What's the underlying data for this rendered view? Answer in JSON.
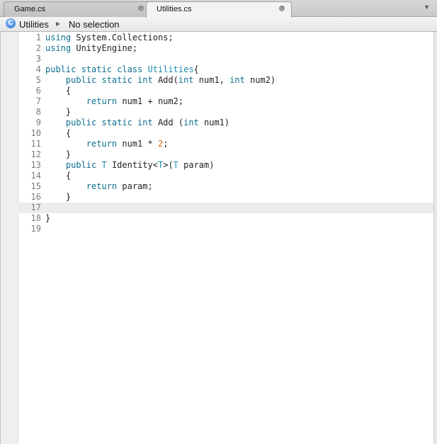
{
  "tabs": [
    {
      "label": "Game.cs"
    },
    {
      "label": "Utilities.cs"
    }
  ],
  "breadcrumb": {
    "class_icon_letter": "C",
    "class_name": "Utilities",
    "member": "No selection"
  },
  "editor": {
    "current_line": 17,
    "lines": [
      {
        "n": "1",
        "tokens": [
          {
            "t": "using",
            "c": "kw"
          },
          {
            "t": " System.Collections;",
            "c": "txt"
          }
        ]
      },
      {
        "n": "2",
        "tokens": [
          {
            "t": "using",
            "c": "kw"
          },
          {
            "t": " UnityEngine;",
            "c": "txt"
          }
        ]
      },
      {
        "n": "3",
        "tokens": []
      },
      {
        "n": "4",
        "tokens": [
          {
            "t": "public static class",
            "c": "kw"
          },
          {
            "t": " ",
            "c": "txt"
          },
          {
            "t": "Utilities",
            "c": "ty"
          },
          {
            "t": "{",
            "c": "txt"
          }
        ]
      },
      {
        "n": "5",
        "tokens": [
          {
            "t": "    ",
            "c": "txt"
          },
          {
            "t": "public static int",
            "c": "kw"
          },
          {
            "t": " Add(",
            "c": "txt"
          },
          {
            "t": "int",
            "c": "kw"
          },
          {
            "t": " num1, ",
            "c": "txt"
          },
          {
            "t": "int",
            "c": "kw"
          },
          {
            "t": " num2)",
            "c": "txt"
          }
        ]
      },
      {
        "n": "6",
        "tokens": [
          {
            "t": "    {",
            "c": "txt"
          }
        ]
      },
      {
        "n": "7",
        "tokens": [
          {
            "t": "        ",
            "c": "txt"
          },
          {
            "t": "return",
            "c": "kw"
          },
          {
            "t": " num1 + num2;",
            "c": "txt"
          }
        ]
      },
      {
        "n": "8",
        "tokens": [
          {
            "t": "    }",
            "c": "txt"
          }
        ]
      },
      {
        "n": "9",
        "tokens": [
          {
            "t": "    ",
            "c": "txt"
          },
          {
            "t": "public static int",
            "c": "kw"
          },
          {
            "t": " Add (",
            "c": "txt"
          },
          {
            "t": "int",
            "c": "kw"
          },
          {
            "t": " num1)",
            "c": "txt"
          }
        ]
      },
      {
        "n": "10",
        "tokens": [
          {
            "t": "    {",
            "c": "txt"
          }
        ]
      },
      {
        "n": "11",
        "tokens": [
          {
            "t": "        ",
            "c": "txt"
          },
          {
            "t": "return",
            "c": "kw"
          },
          {
            "t": " num1 * ",
            "c": "txt"
          },
          {
            "t": "2",
            "c": "num"
          },
          {
            "t": ";",
            "c": "txt"
          }
        ]
      },
      {
        "n": "12",
        "tokens": [
          {
            "t": "    }",
            "c": "txt"
          }
        ]
      },
      {
        "n": "13",
        "tokens": [
          {
            "t": "    ",
            "c": "txt"
          },
          {
            "t": "public",
            "c": "kw"
          },
          {
            "t": " ",
            "c": "txt"
          },
          {
            "t": "T",
            "c": "ty"
          },
          {
            "t": " Identity<",
            "c": "txt"
          },
          {
            "t": "T",
            "c": "ty"
          },
          {
            "t": ">(",
            "c": "txt"
          },
          {
            "t": "T",
            "c": "ty"
          },
          {
            "t": " param)",
            "c": "txt"
          }
        ]
      },
      {
        "n": "14",
        "tokens": [
          {
            "t": "    {",
            "c": "txt"
          }
        ]
      },
      {
        "n": "15",
        "tokens": [
          {
            "t": "        ",
            "c": "txt"
          },
          {
            "t": "return",
            "c": "kw"
          },
          {
            "t": " param;",
            "c": "txt"
          }
        ]
      },
      {
        "n": "16",
        "tokens": [
          {
            "t": "    }",
            "c": "txt"
          }
        ]
      },
      {
        "n": "17",
        "tokens": []
      },
      {
        "n": "18",
        "tokens": [
          {
            "t": "}",
            "c": "txt"
          }
        ]
      },
      {
        "n": "19",
        "tokens": []
      }
    ]
  },
  "colors": {
    "keyword": "#0c6f90",
    "type": "#1b8cad",
    "number": "#d26818",
    "text": "#222222"
  }
}
